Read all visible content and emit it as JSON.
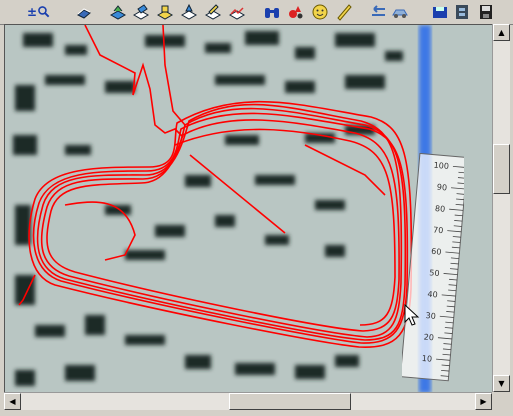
{
  "toolbar": {
    "zoom_label": "±",
    "overlay_text": "",
    "icons": [
      "zoom-in-out-icon",
      "book-icon",
      "layer-1-icon",
      "layer-2-icon",
      "layer-3-icon",
      "layer-4-icon",
      "layer-5-icon",
      "layer-6-icon",
      "binoculars-icon",
      "markers-icon",
      "smiley-icon",
      "ruler-icon",
      "back-icon",
      "car-icon",
      "save-disk-icon",
      "film-icon",
      "floppy-icon"
    ]
  },
  "ruler": {
    "ticks": [
      "100",
      "90",
      "80",
      "70",
      "60",
      "50",
      "40",
      "30",
      "20",
      "10"
    ]
  },
  "colors": {
    "track": "#ff0000",
    "river": "#3c78e6",
    "map_bg": "#b9c6c3",
    "blocks": "#1e2a28"
  }
}
